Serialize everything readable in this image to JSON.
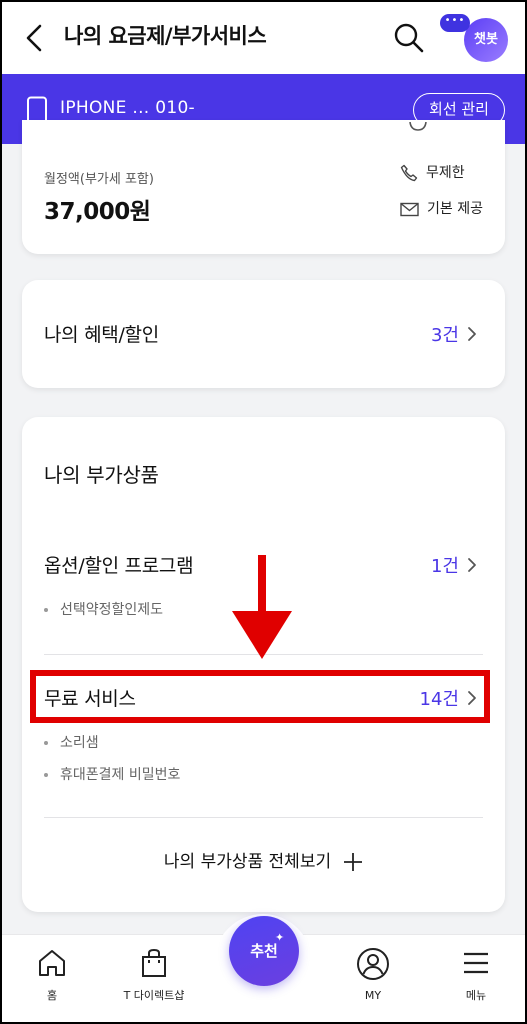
{
  "header": {
    "title": "나의 요금제/부가서비스",
    "chatbot_dots": "•••",
    "chatbot_label": "챗봇"
  },
  "line": {
    "text": "IPHONE ...  010-",
    "manage_label": "회선 관리"
  },
  "plan": {
    "monthly_label": "월정액(부가세 포함)",
    "price": "37,000원",
    "features": [
      "무제한",
      "기본 제공"
    ]
  },
  "benefits": {
    "label": "나의 혜택/할인",
    "count": "3건"
  },
  "addons": {
    "title": "나의 부가상품",
    "options": {
      "label": "옵션/할인 프로그램",
      "count": "1건",
      "items": [
        "선택약정할인제도"
      ]
    },
    "free": {
      "label": "무료 서비스",
      "count": "14건",
      "items": [
        "소리샘",
        "휴대폰결제 비밀번호"
      ]
    },
    "view_all": "나의 부가상품 전체보기"
  },
  "bottom_nav": {
    "home": "홈",
    "shop": "T 다이렉트샵",
    "recommend": "추천",
    "my": "MY",
    "menu": "메뉴"
  },
  "colors": {
    "brand": "#4a36e6",
    "highlight": "#e00000"
  }
}
